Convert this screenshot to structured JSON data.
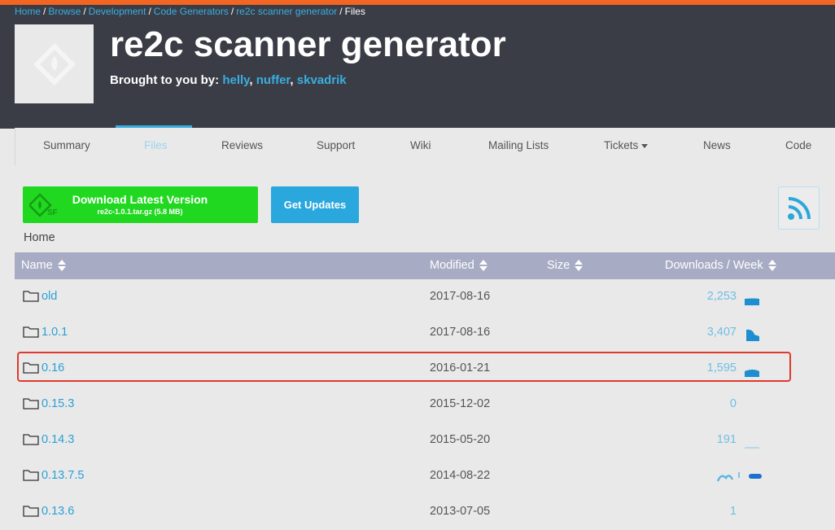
{
  "breadcrumb": {
    "items": [
      "Home",
      "Browse",
      "Development",
      "Code Generators",
      "re2c scanner generator"
    ],
    "current": "Files",
    "separator": "/"
  },
  "project": {
    "title": "re2c scanner generator",
    "brought_by_label": "Brought to you by:",
    "authors": [
      "helly",
      "nuffer",
      "skvadrik"
    ]
  },
  "tabs": [
    {
      "label": "Summary",
      "active": false
    },
    {
      "label": "Files",
      "active": true
    },
    {
      "label": "Reviews",
      "active": false
    },
    {
      "label": "Support",
      "active": false
    },
    {
      "label": "Wiki",
      "active": false
    },
    {
      "label": "Mailing Lists",
      "active": false
    },
    {
      "label": "Tickets",
      "active": false,
      "dropdown": true
    },
    {
      "label": "News",
      "active": false
    },
    {
      "label": "Code",
      "active": false
    }
  ],
  "actions": {
    "download_label": "Download Latest Version",
    "download_file": "re2c-1.0.1.tar.gz (5.8 MB)",
    "get_updates_label": "Get Updates",
    "rss_icon": "rss-icon"
  },
  "location": "Home",
  "table": {
    "headers": {
      "name": "Name",
      "modified": "Modified",
      "size": "Size",
      "downloads": "Downloads / Week"
    },
    "rows": [
      {
        "name": "old",
        "modified": "2017-08-16",
        "downloads": "2,253",
        "highlighted": false
      },
      {
        "name": "1.0.1",
        "modified": "2017-08-16",
        "downloads": "3,407",
        "highlighted": false
      },
      {
        "name": "0.16",
        "modified": "2016-01-21",
        "downloads": "1,595",
        "highlighted": true
      },
      {
        "name": "0.15.3",
        "modified": "2015-12-02",
        "downloads": "0",
        "highlighted": false
      },
      {
        "name": "0.14.3",
        "modified": "2015-05-20",
        "downloads": "191",
        "highlighted": false
      },
      {
        "name": "0.13.7.5",
        "modified": "2014-08-22",
        "downloads": "",
        "highlighted": false
      },
      {
        "name": "0.13.6",
        "modified": "2013-07-05",
        "downloads": "1",
        "highlighted": false
      }
    ]
  },
  "colors": {
    "header_bg": "#3b3d46",
    "link": "#3aaee0",
    "download_green": "#21d821",
    "updates_blue": "#2aa7dc",
    "table_header": "#a8abc4",
    "highlight_border": "#e03a2e"
  }
}
